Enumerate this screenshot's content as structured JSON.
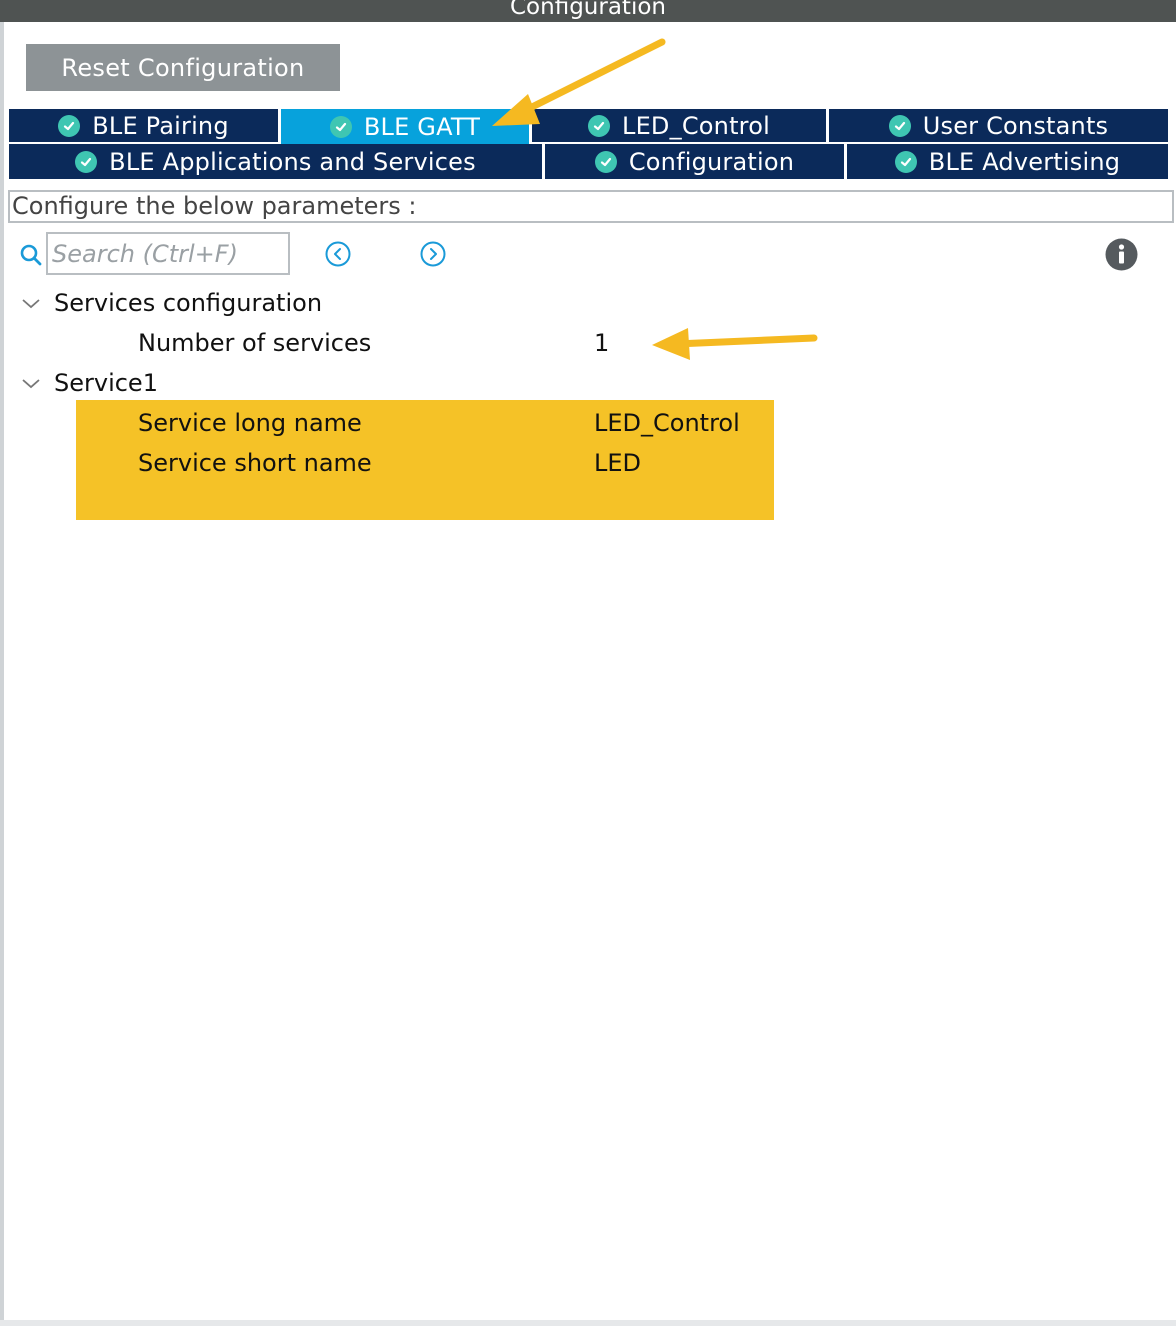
{
  "window": {
    "title": "Configuration"
  },
  "toolbar": {
    "reset_label": "Reset Configuration"
  },
  "tabs": [
    {
      "label": "BLE Pairing",
      "active": false
    },
    {
      "label": "BLE GATT",
      "active": true
    },
    {
      "label": "LED_Control",
      "active": false
    },
    {
      "label": "User Constants",
      "active": false
    },
    {
      "label": "BLE Applications and Services",
      "active": false
    },
    {
      "label": "Configuration",
      "active": false
    },
    {
      "label": "BLE Advertising",
      "active": false
    }
  ],
  "params": {
    "header": "Configure the below parameters :"
  },
  "search": {
    "placeholder": "Search (Ctrl+F)",
    "value": ""
  },
  "tree": {
    "services_config": {
      "label": "Services configuration",
      "rows": [
        {
          "name": "Number of services",
          "value": "1"
        }
      ]
    },
    "service1": {
      "label": "Service1",
      "rows": [
        {
          "name": "Service long name",
          "value": "LED_Control"
        },
        {
          "name": "Service short name",
          "value": "LED"
        }
      ]
    }
  },
  "icons": {
    "tab_status": "check-circle-icon",
    "search": "search-icon",
    "prev": "chevron-left-circle-icon",
    "next": "chevron-right-circle-icon",
    "info": "info-icon",
    "expand": "chevron-down-icon",
    "annotation": "arrow-icon"
  },
  "colors": {
    "tab_bg": "#0b2a5a",
    "tab_active_bg": "#07a2dc",
    "check": "#3fc6b2",
    "highlight": "#f5c227",
    "arrow": "#f5b921",
    "reset_btn": "#8d9396"
  }
}
